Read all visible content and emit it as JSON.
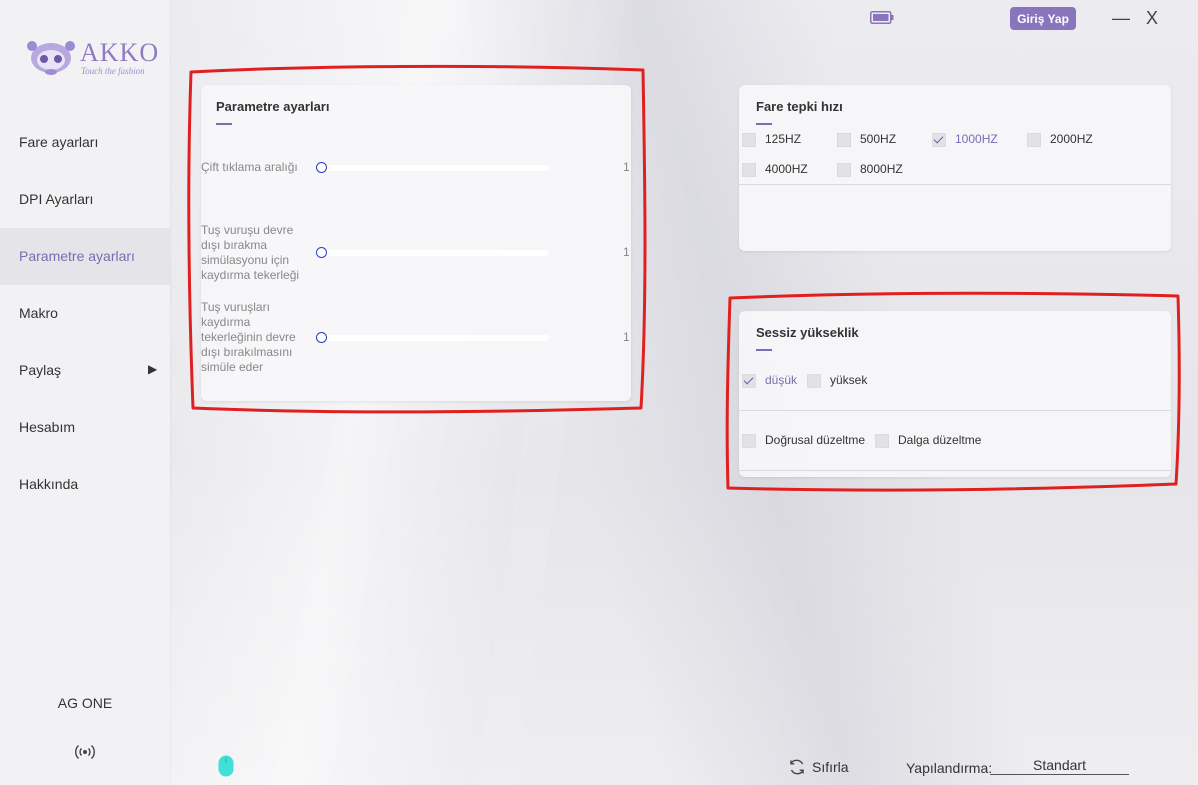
{
  "brand": {
    "name": "AKKO",
    "tagline": "Touch the fashion",
    "accent": "#7d6ab2"
  },
  "sidebar": {
    "items": [
      {
        "label": "Fare ayarları"
      },
      {
        "label": "DPI Ayarları"
      },
      {
        "label": "Parametre ayarları",
        "active": true
      },
      {
        "label": "Makro"
      },
      {
        "label": "Paylaş",
        "arrow": "▶"
      },
      {
        "label": "Hesabım"
      },
      {
        "label": "Hakkında"
      }
    ],
    "device_name": "AG ONE",
    "wireless_icon": "wireless-signal-icon"
  },
  "topbar": {
    "login_label": "Giriş Yap",
    "minimize_label": "—",
    "close_label": "X",
    "battery_icon": "battery-icon"
  },
  "param_card": {
    "title": "Parametre ayarları",
    "sliders": [
      {
        "label": "Çift tıklama aralığı",
        "value": "1"
      },
      {
        "label": "Tuş vuruşu devre dışı bırakma simülasyonu için kaydırma tekerleği",
        "value": "1"
      },
      {
        "label": "Tuş vuruşları kaydırma tekerleğinin devre dışı bırakılmasını simüle eder",
        "value": "1"
      }
    ]
  },
  "rate_card": {
    "title": "Fare tepki hızı",
    "options": [
      {
        "label": "125HZ",
        "checked": false
      },
      {
        "label": "500HZ",
        "checked": false
      },
      {
        "label": "1000HZ",
        "checked": true
      },
      {
        "label": "2000HZ",
        "checked": false
      },
      {
        "label": "4000HZ",
        "checked": false
      },
      {
        "label": "8000HZ",
        "checked": false
      }
    ]
  },
  "silent_card": {
    "title": "Sessiz yükseklik",
    "height_options": [
      {
        "label": "düşük",
        "checked": true
      },
      {
        "label": "yüksek",
        "checked": false
      }
    ],
    "correction_options": [
      {
        "label": "Doğrusal düzeltme",
        "checked": false
      },
      {
        "label": "Dalga düzeltme",
        "checked": false
      }
    ]
  },
  "bottombar": {
    "reset_label": "Sıfırla",
    "config_label": "Yapılandırma:",
    "config_value": "Standart",
    "mouse_icon": "mouse-icon",
    "mouse_color": "#3ee0d8"
  },
  "annotation_color": "#e02020"
}
